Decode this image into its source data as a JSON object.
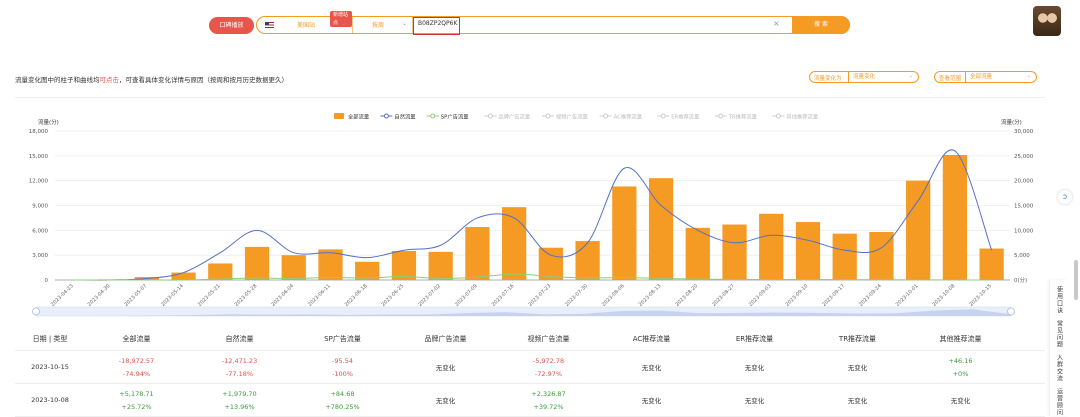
{
  "header": {
    "traffic_button": "口碑播放",
    "site": "美国站",
    "new_badge": "新增站点",
    "mode": "按周",
    "asin": "B08ZP2QP6K",
    "clear": "×",
    "search_button": "搜 索"
  },
  "help": {
    "prefix": "流量变化图中的柱子和曲线均",
    "link": "可点击",
    "suffix": "，可查看具体变化详情与原因（按周和按月历史数据更久）"
  },
  "filters": {
    "change_label": "流量变化为",
    "change_value": "流量变化",
    "range_label": "查看范围",
    "range_value": "全部流量"
  },
  "chart_data": {
    "type": "bar",
    "legend": [
      {
        "name": "全部流量",
        "color": "#f59a23",
        "active": true,
        "kind": "bar"
      },
      {
        "name": "自然流量",
        "color": "#5470c6",
        "active": true,
        "kind": "line"
      },
      {
        "name": "SP广告流量",
        "color": "#91cc75",
        "active": true,
        "kind": "line"
      },
      {
        "name": "品牌广告流量",
        "color": "#cccccc",
        "active": false,
        "kind": "line"
      },
      {
        "name": "视频广告流量",
        "color": "#cccccc",
        "active": false,
        "kind": "line"
      },
      {
        "name": "AC推荐流量",
        "color": "#cccccc",
        "active": false,
        "kind": "line"
      },
      {
        "name": "ER推荐流量",
        "color": "#cccccc",
        "active": false,
        "kind": "line"
      },
      {
        "name": "TR推荐流量",
        "color": "#cccccc",
        "active": false,
        "kind": "line"
      },
      {
        "name": "其他推荐流量",
        "color": "#cccccc",
        "active": false,
        "kind": "line"
      }
    ],
    "ylabel_left": "流量(分)",
    "ylabel_right": "流量(分)",
    "ylim_left": [
      0,
      18000
    ],
    "ylim_right": [
      0,
      30000
    ],
    "yticks_left": [
      "0",
      "3,000",
      "6,000",
      "9,000",
      "12,000",
      "15,000",
      "18,000"
    ],
    "yticks_right": [
      "0(分)",
      "5,000",
      "10,000",
      "15,000",
      "20,000",
      "25,000",
      "30,000"
    ],
    "categories": [
      "2023-04-23",
      "2023-04-30",
      "2023-05-07",
      "2023-05-14",
      "2023-05-21",
      "2023-05-28",
      "2023-06-04",
      "2023-06-11",
      "2023-06-18",
      "2023-06-25",
      "2023-07-02",
      "2023-07-09",
      "2023-07-16",
      "2023-07-23",
      "2023-07-30",
      "2023-08-06",
      "2023-08-13",
      "2023-08-20",
      "2023-08-27",
      "2023-09-03",
      "2023-09-10",
      "2023-09-17",
      "2023-09-24",
      "2023-10-01",
      "2023-10-08",
      "2023-10-15"
    ],
    "series": [
      {
        "name": "全部流量",
        "axis": "left",
        "values": [
          0,
          80,
          350,
          900,
          2000,
          4000,
          3000,
          3700,
          2200,
          3500,
          3400,
          6400,
          8800,
          3900,
          4700,
          11300,
          12300,
          6300,
          6700,
          8000,
          7000,
          5600,
          5800,
          12000,
          15100,
          3800
        ]
      },
      {
        "name": "自然流量",
        "axis": "right",
        "values": [
          0,
          0,
          300,
          1500,
          5500,
          10000,
          5500,
          5500,
          4500,
          6000,
          7000,
          12500,
          12500,
          5000,
          7500,
          22500,
          15000,
          10000,
          7500,
          9000,
          8000,
          6000,
          6500,
          16000,
          26000,
          6000
        ]
      },
      {
        "name": "SP广告流量",
        "axis": "right",
        "values": [
          0,
          0,
          0,
          0,
          200,
          400,
          300,
          500,
          400,
          700,
          300,
          600,
          1200,
          700,
          400,
          500,
          300,
          200,
          100,
          100,
          100,
          80,
          50,
          20,
          10,
          0
        ]
      }
    ]
  },
  "table": {
    "headers": [
      "日期 | 类型",
      "全部流量",
      "自然流量",
      "SP广告流量",
      "品牌广告流量",
      "视频广告流量",
      "AC推荐流量",
      "ER推荐流量",
      "TR推荐流量",
      "其他推荐流量"
    ],
    "rows": [
      {
        "date": "2023-10-15",
        "cells": [
          {
            "a": "-18,972.57",
            "b": "-74.94%",
            "tone": "neg"
          },
          {
            "a": "-12,471.23",
            "b": "-77.18%",
            "tone": "neg"
          },
          {
            "a": "-95.54",
            "b": "-100%",
            "tone": "neg"
          },
          {
            "a": "无变化",
            "b": "",
            "tone": "plain"
          },
          {
            "a": "-5,972.78",
            "b": "-72.97%",
            "tone": "neg"
          },
          {
            "a": "无变化",
            "b": "",
            "tone": "plain"
          },
          {
            "a": "无变化",
            "b": "",
            "tone": "plain"
          },
          {
            "a": "无变化",
            "b": "",
            "tone": "plain"
          },
          {
            "a": "+46.16",
            "b": "+0%",
            "tone": "pos"
          }
        ]
      },
      {
        "date": "2023-10-08",
        "cells": [
          {
            "a": "+5,178.71",
            "b": "+25.72%",
            "tone": "pos"
          },
          {
            "a": "+1,979.70",
            "b": "+13.96%",
            "tone": "pos"
          },
          {
            "a": "+84.68",
            "b": "+780.25%",
            "tone": "pos"
          },
          {
            "a": "无变化",
            "b": "",
            "tone": "plain"
          },
          {
            "a": "+2,326.87",
            "b": "+39.72%",
            "tone": "pos"
          },
          {
            "a": "无变化",
            "b": "",
            "tone": "plain"
          },
          {
            "a": "无变化",
            "b": "",
            "tone": "plain"
          },
          {
            "a": "无变化",
            "b": "",
            "tone": "plain"
          },
          {
            "a": "无变化",
            "b": "",
            "tone": "plain"
          }
        ]
      }
    ]
  },
  "sidebar": {
    "items": [
      "使用口诀",
      "常见问题",
      "入群交流",
      "运营顾问"
    ]
  }
}
